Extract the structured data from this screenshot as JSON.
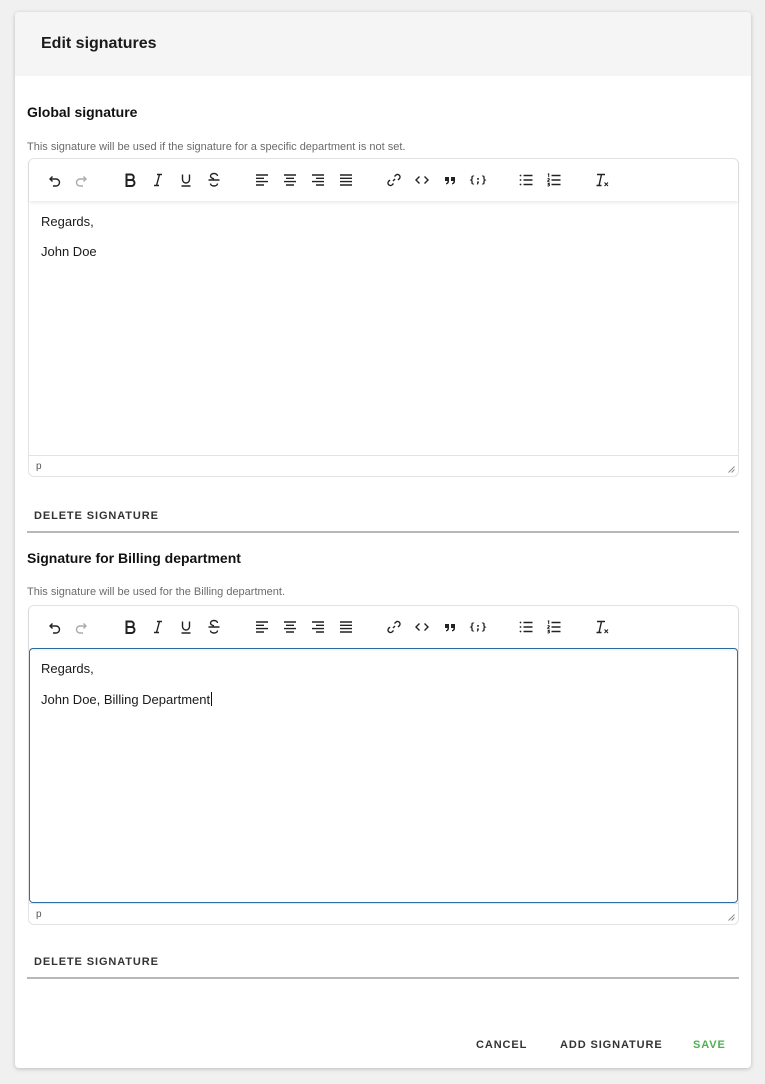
{
  "dialog": {
    "title": "Edit signatures"
  },
  "global": {
    "title": "Global signature",
    "description": "This signature will be used if the signature for a specific department is not set.",
    "lines": [
      "Regards,",
      "John Doe"
    ],
    "status_path": "p",
    "delete_label": "DELETE SIGNATURE"
  },
  "billing": {
    "title": "Signature for Billing department",
    "description": "This signature will be used for the Billing department.",
    "lines": [
      "Regards,",
      "John Doe, Billing Department"
    ],
    "status_path": "p",
    "delete_label": "DELETE SIGNATURE"
  },
  "toolbar": {
    "code_block_label": "{;}"
  },
  "footer": {
    "cancel_label": "CANCEL",
    "add_label": "ADD SIGNATURE",
    "save_label": "SAVE"
  },
  "colors": {
    "save": "#4caf50",
    "focus_border": "#2f6fa8",
    "header_bg": "#f5f5f5"
  },
  "icons": [
    "undo-icon",
    "redo-icon",
    "bold-icon",
    "italic-icon",
    "underline-icon",
    "strikethrough-icon",
    "align-left-icon",
    "align-center-icon",
    "align-right-icon",
    "align-justify-icon",
    "link-icon",
    "code-icon",
    "blockquote-icon",
    "code-block-icon",
    "bullet-list-icon",
    "numbered-list-icon",
    "clear-formatting-icon"
  ]
}
